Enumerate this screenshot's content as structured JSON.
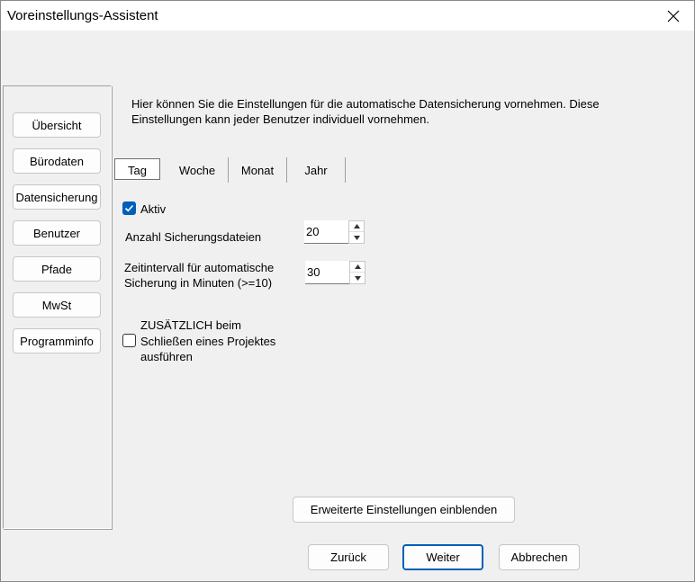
{
  "window": {
    "title": "Voreinstellungs-Assistent",
    "close_icon": "close-icon"
  },
  "sidebar": {
    "items": [
      {
        "label": "Übersicht"
      },
      {
        "label": "Bürodaten"
      },
      {
        "label": "Datensicherung"
      },
      {
        "label": "Benutzer"
      },
      {
        "label": "Pfade"
      },
      {
        "label": "MwSt"
      },
      {
        "label": "Programminfo"
      }
    ]
  },
  "info": {
    "line1": "Hier können Sie die Einstellungen für die automatische Datensicherung vornehmen. Diese",
    "line2": "Einstellungen kann jeder Benutzer individuell vornehmen."
  },
  "tabs": [
    {
      "label": "Tag",
      "active": true
    },
    {
      "label": "Woche",
      "active": false
    },
    {
      "label": "Monat",
      "active": false
    },
    {
      "label": "Jahr",
      "active": false
    }
  ],
  "form": {
    "aktiv_label": "Aktiv",
    "aktiv_checked": true,
    "anzahl_label": "Anzahl Sicherungsdateien",
    "anzahl_value": "20",
    "intervall_label_line1": "Zeitintervall für automatische",
    "intervall_label_line2": "Sicherung in Minuten (>=10)",
    "intervall_value": "30",
    "zusaetzlich_line1": "ZUSÄTZLICH beim",
    "zusaetzlich_line2": "Schließen eines Projektes",
    "zusaetzlich_line3": "ausführen",
    "zusaetzlich_checked": false
  },
  "buttons": {
    "advanced": "Erweiterte Einstellungen einblenden",
    "back": "Zurück",
    "next": "Weiter",
    "cancel": "Abbrechen"
  },
  "colors": {
    "accent": "#005fb8",
    "background": "#f0f0f0"
  }
}
